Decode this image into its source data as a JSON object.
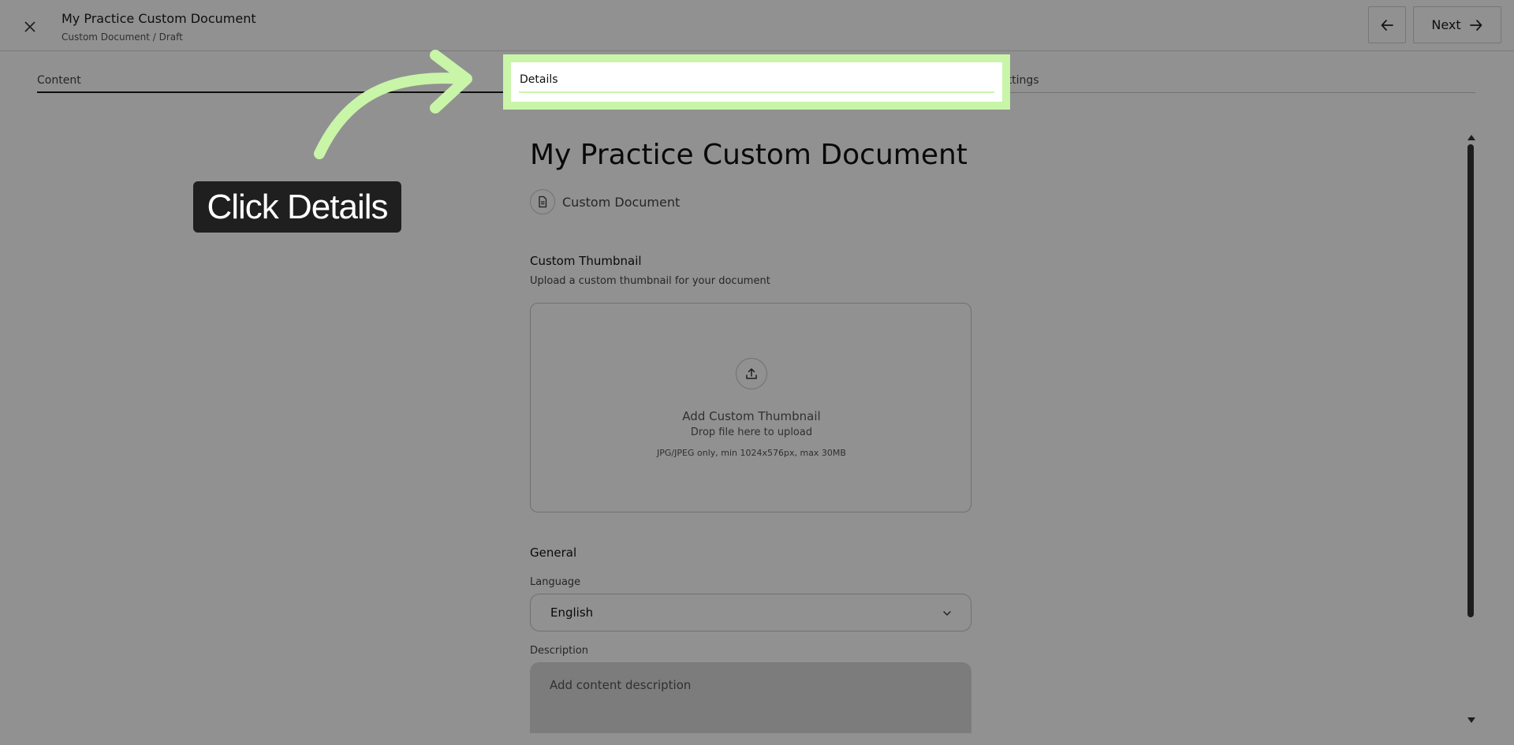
{
  "header": {
    "title": "My Practice Custom Document",
    "breadcrumb": "Custom Document / Draft",
    "next_label": "Next"
  },
  "tabs": [
    {
      "label": "Content",
      "active": true
    },
    {
      "label": "Details",
      "active": false
    },
    {
      "label": "Settings",
      "active": false
    }
  ],
  "tab_settings_visible_text": "ettings",
  "main": {
    "page_title": "My Practice Custom Document",
    "doc_type": "Custom Document",
    "thumbnail": {
      "heading": "Custom Thumbnail",
      "subheading": "Upload a custom thumbnail for your document",
      "dropzone_title": "Add Custom Thumbnail",
      "dropzone_sub": "Drop file here to upload",
      "dropzone_hint": "JPG/JPEG only, min 1024x576px, max 30MB"
    },
    "general": {
      "heading": "General",
      "language_label": "Language",
      "language_value": "English",
      "description_label": "Description",
      "description_placeholder": "Add content description"
    }
  },
  "overlay": {
    "callout_text": "Click Details",
    "highlight_color": "#c8f5a8",
    "callout_bg": "#1f1f1f"
  },
  "icons": {
    "close": "close-icon",
    "back": "arrow-left-icon",
    "next": "arrow-right-icon",
    "doc_type": "document-icon",
    "upload": "upload-icon",
    "select": "chevron-down-icon"
  }
}
